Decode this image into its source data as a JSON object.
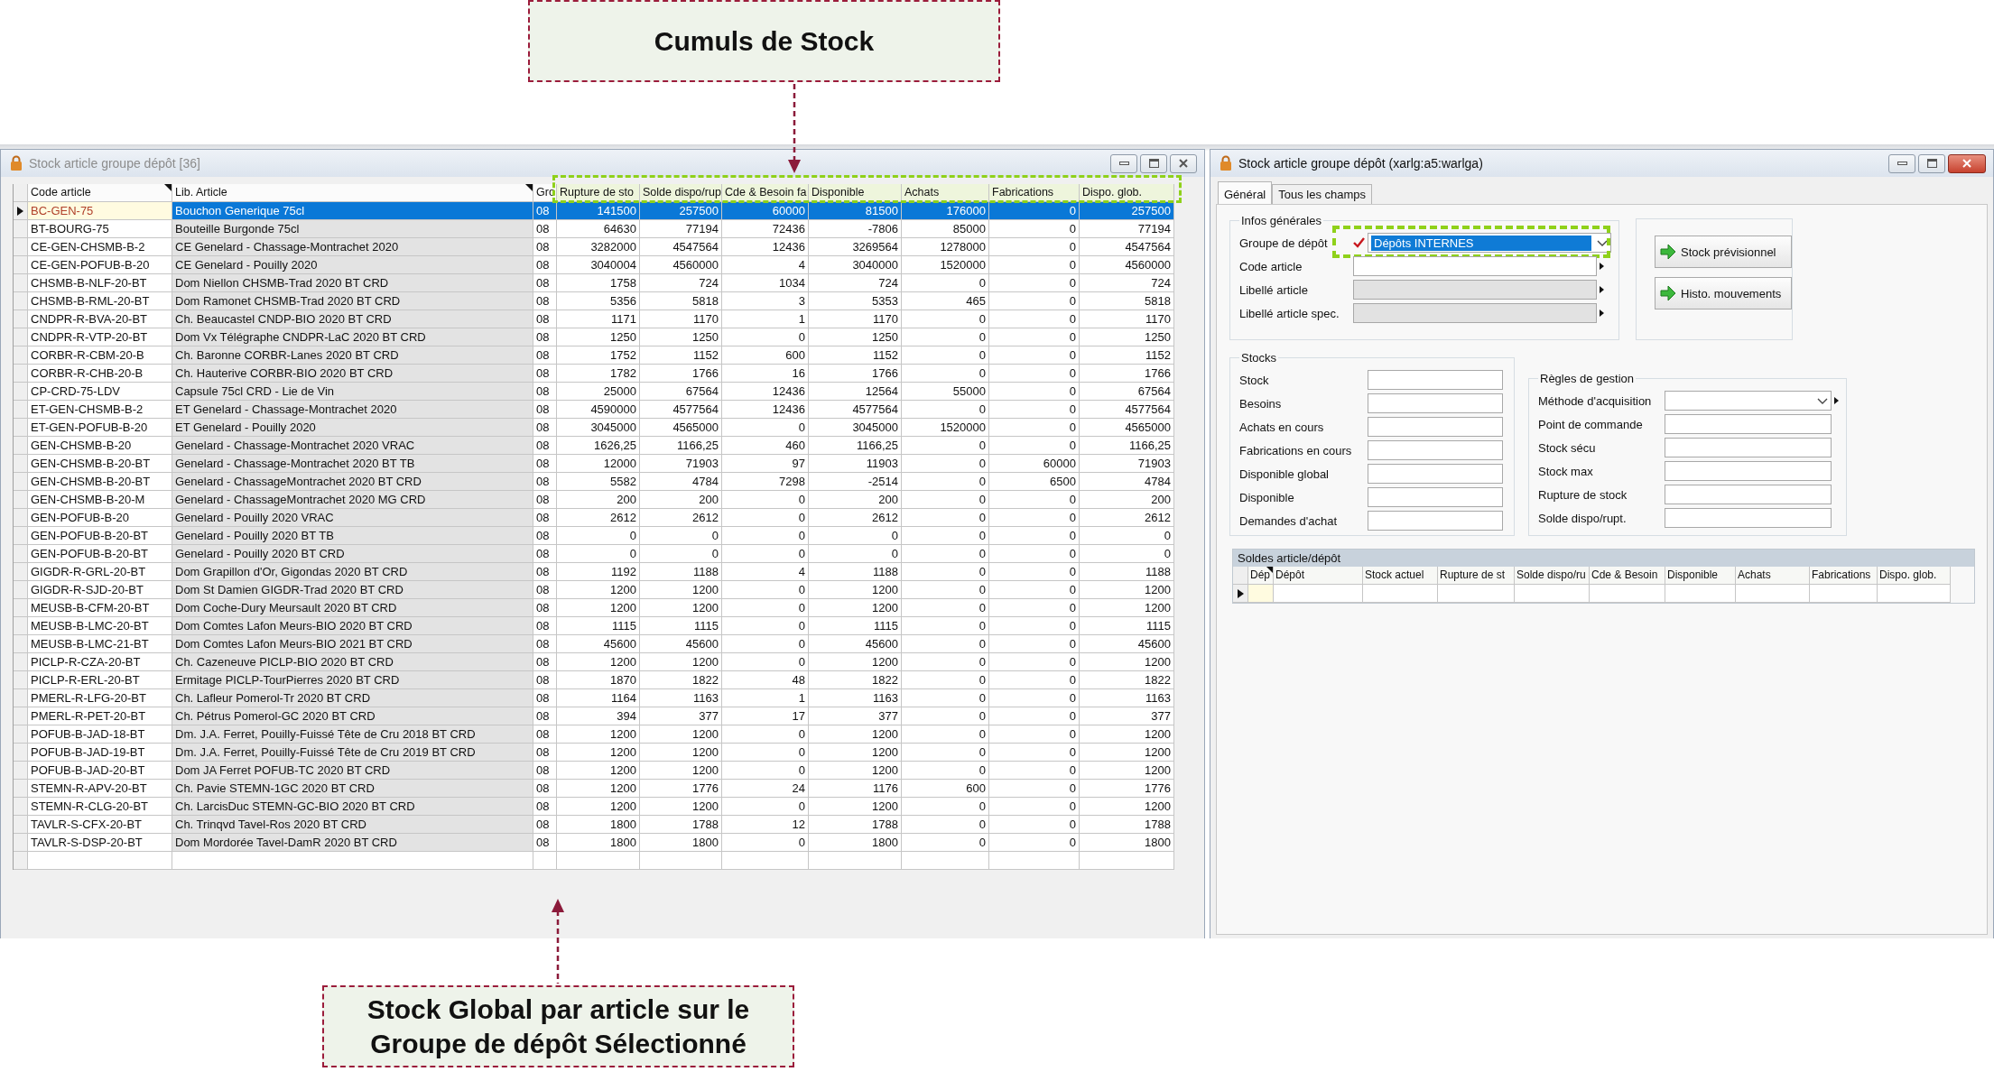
{
  "annotations": [
    {
      "text": "Cumuls de Stock"
    },
    {
      "text": "Stock Global par article sur le Groupe de dépôt Sélectionné"
    }
  ],
  "grid_window": {
    "title": "Stock article groupe dépôt [36]",
    "active": false,
    "columns": [
      {
        "label": "Code article",
        "sort_marker": true,
        "highlighted": false
      },
      {
        "label": "Lib. Article",
        "sort_marker": true,
        "highlighted": false
      },
      {
        "label": "Gro",
        "highlighted": false
      },
      {
        "label": "Rupture de sto",
        "highlighted": true
      },
      {
        "label": "Solde dispo/rup",
        "highlighted": true
      },
      {
        "label": "Cde & Besoin fa",
        "highlighted": true
      },
      {
        "label": "Disponible",
        "highlighted": true
      },
      {
        "label": "Achats",
        "highlighted": true
      },
      {
        "label": "Fabrications",
        "highlighted": true
      },
      {
        "label": "Dispo. glob.",
        "highlighted": true
      }
    ],
    "rows": [
      {
        "selected": true,
        "cells": [
          "BC-GEN-75",
          "Bouchon Generique 75cl",
          "08",
          "141500",
          "257500",
          "60000",
          "81500",
          "176000",
          "0",
          "257500"
        ]
      },
      {
        "selected": false,
        "cells": [
          "BT-BOURG-75",
          "Bouteille Burgonde 75cl",
          "08",
          "64630",
          "77194",
          "72436",
          "-7806",
          "85000",
          "0",
          "77194"
        ]
      },
      {
        "selected": false,
        "cells": [
          "CE-GEN-CHSMB-B-2",
          "CE Genelard - Chassage-Montrachet 2020",
          "08",
          "3282000",
          "4547564",
          "12436",
          "3269564",
          "1278000",
          "0",
          "4547564"
        ]
      },
      {
        "selected": false,
        "cells": [
          "CE-GEN-POFUB-B-20",
          "CE Genelard - Pouilly 2020",
          "08",
          "3040004",
          "4560000",
          "4",
          "3040000",
          "1520000",
          "0",
          "4560000"
        ]
      },
      {
        "selected": false,
        "cells": [
          "CHSMB-B-NLF-20-BT",
          "Dom Niellon CHSMB-Trad 2020 BT CRD",
          "08",
          "1758",
          "724",
          "1034",
          "724",
          "0",
          "0",
          "724"
        ]
      },
      {
        "selected": false,
        "cells": [
          "CHSMB-B-RML-20-BT",
          "Dom Ramonet CHSMB-Trad 2020 BT CRD",
          "08",
          "5356",
          "5818",
          "3",
          "5353",
          "465",
          "0",
          "5818"
        ]
      },
      {
        "selected": false,
        "cells": [
          "CNDPR-R-BVA-20-BT",
          "Ch. Beaucastel CNDP-BIO 2020 BT CRD",
          "08",
          "1171",
          "1170",
          "1",
          "1170",
          "0",
          "0",
          "1170"
        ]
      },
      {
        "selected": false,
        "cells": [
          "CNDPR-R-VTP-20-BT",
          "Dom Vx Télégraphe CNDPR-LaC 2020 BT CRD",
          "08",
          "1250",
          "1250",
          "0",
          "1250",
          "0",
          "0",
          "1250"
        ]
      },
      {
        "selected": false,
        "cells": [
          "CORBR-R-CBM-20-B",
          "Ch. Baronne CORBR-Lanes 2020 BT CRD",
          "08",
          "1752",
          "1152",
          "600",
          "1152",
          "0",
          "0",
          "1152"
        ]
      },
      {
        "selected": false,
        "cells": [
          "CORBR-R-CHB-20-B",
          "Ch. Hauterive CORBR-BIO 2020 BT CRD",
          "08",
          "1782",
          "1766",
          "16",
          "1766",
          "0",
          "0",
          "1766"
        ]
      },
      {
        "selected": false,
        "cells": [
          "CP-CRD-75-LDV",
          "Capsule 75cl CRD - Lie de Vin",
          "08",
          "25000",
          "67564",
          "12436",
          "12564",
          "55000",
          "0",
          "67564"
        ]
      },
      {
        "selected": false,
        "cells": [
          "ET-GEN-CHSMB-B-2",
          "ET Genelard - Chassage-Montrachet 2020",
          "08",
          "4590000",
          "4577564",
          "12436",
          "4577564",
          "0",
          "0",
          "4577564"
        ]
      },
      {
        "selected": false,
        "cells": [
          "ET-GEN-POFUB-B-20",
          "ET Genelard - Pouilly 2020",
          "08",
          "3045000",
          "4565000",
          "0",
          "3045000",
          "1520000",
          "0",
          "4565000"
        ]
      },
      {
        "selected": false,
        "cells": [
          "GEN-CHSMB-B-20",
          "Genelard - Chassage-Montrachet 2020 VRAC",
          "08",
          "1626,25",
          "1166,25",
          "460",
          "1166,25",
          "0",
          "0",
          "1166,25"
        ]
      },
      {
        "selected": false,
        "cells": [
          "GEN-CHSMB-B-20-BT",
          "Genelard - Chassage-Montrachet 2020 BT TB",
          "08",
          "12000",
          "71903",
          "97",
          "11903",
          "0",
          "60000",
          "71903"
        ]
      },
      {
        "selected": false,
        "cells": [
          "GEN-CHSMB-B-20-BT",
          "Genelard - ChassageMontrachet 2020 BT CRD",
          "08",
          "5582",
          "4784",
          "7298",
          "-2514",
          "0",
          "6500",
          "4784"
        ]
      },
      {
        "selected": false,
        "cells": [
          "GEN-CHSMB-B-20-M",
          "Genelard - ChassageMontrachet 2020 MG CRD",
          "08",
          "200",
          "200",
          "0",
          "200",
          "0",
          "0",
          "200"
        ]
      },
      {
        "selected": false,
        "cells": [
          "GEN-POFUB-B-20",
          "Genelard - Pouilly 2020 VRAC",
          "08",
          "2612",
          "2612",
          "0",
          "2612",
          "0",
          "0",
          "2612"
        ]
      },
      {
        "selected": false,
        "cells": [
          "GEN-POFUB-B-20-BT",
          "Genelard - Pouilly 2020 BT TB",
          "08",
          "0",
          "0",
          "0",
          "0",
          "0",
          "0",
          "0"
        ]
      },
      {
        "selected": false,
        "cells": [
          "GEN-POFUB-B-20-BT",
          "Genelard - Pouilly 2020 BT CRD",
          "08",
          "0",
          "0",
          "0",
          "0",
          "0",
          "0",
          "0"
        ]
      },
      {
        "selected": false,
        "cells": [
          "GIGDR-R-GRL-20-BT",
          "Dom Grapillon d'Or, Gigondas 2020 BT CRD",
          "08",
          "1192",
          "1188",
          "4",
          "1188",
          "0",
          "0",
          "1188"
        ]
      },
      {
        "selected": false,
        "cells": [
          "GIGDR-R-SJD-20-BT",
          "Dom St Damien GIGDR-Trad 2020 BT CRD",
          "08",
          "1200",
          "1200",
          "0",
          "1200",
          "0",
          "0",
          "1200"
        ]
      },
      {
        "selected": false,
        "cells": [
          "MEUSB-B-CFM-20-BT",
          "Dom Coche-Dury Meursault 2020 BT CRD",
          "08",
          "1200",
          "1200",
          "0",
          "1200",
          "0",
          "0",
          "1200"
        ]
      },
      {
        "selected": false,
        "cells": [
          "MEUSB-B-LMC-20-BT",
          "Dom Comtes Lafon Meurs-BIO 2020 BT CRD",
          "08",
          "1115",
          "1115",
          "0",
          "1115",
          "0",
          "0",
          "1115"
        ]
      },
      {
        "selected": false,
        "cells": [
          "MEUSB-B-LMC-21-BT",
          "Dom Comtes Lafon Meurs-BIO 2021 BT CRD",
          "08",
          "45600",
          "45600",
          "0",
          "45600",
          "0",
          "0",
          "45600"
        ]
      },
      {
        "selected": false,
        "cells": [
          "PICLP-R-CZA-20-BT",
          "Ch. Cazeneuve PICLP-BIO 2020 BT CRD",
          "08",
          "1200",
          "1200",
          "0",
          "1200",
          "0",
          "0",
          "1200"
        ]
      },
      {
        "selected": false,
        "cells": [
          "PICLP-R-ERL-20-BT",
          "Ermitage PICLP-TourPierres 2020 BT CRD",
          "08",
          "1870",
          "1822",
          "48",
          "1822",
          "0",
          "0",
          "1822"
        ]
      },
      {
        "selected": false,
        "cells": [
          "PMERL-R-LFG-20-BT",
          "Ch. Lafleur Pomerol-Tr 2020 BT CRD",
          "08",
          "1164",
          "1163",
          "1",
          "1163",
          "0",
          "0",
          "1163"
        ]
      },
      {
        "selected": false,
        "cells": [
          "PMERL-R-PET-20-BT",
          "Ch. Pétrus Pomerol-GC 2020 BT CRD",
          "08",
          "394",
          "377",
          "17",
          "377",
          "0",
          "0",
          "377"
        ]
      },
      {
        "selected": false,
        "cells": [
          "POFUB-B-JAD-18-BT",
          "Dm. J.A. Ferret, Pouilly-Fuissé Tête de Cru 2018 BT CRD",
          "08",
          "1200",
          "1200",
          "0",
          "1200",
          "0",
          "0",
          "1200"
        ]
      },
      {
        "selected": false,
        "cells": [
          "POFUB-B-JAD-19-BT",
          "Dm. J.A. Ferret, Pouilly-Fuissé Tête de Cru 2019 BT CRD",
          "08",
          "1200",
          "1200",
          "0",
          "1200",
          "0",
          "0",
          "1200"
        ]
      },
      {
        "selected": false,
        "cells": [
          "POFUB-B-JAD-20-BT",
          "Dom JA Ferret POFUB-TC 2020 BT CRD",
          "08",
          "1200",
          "1200",
          "0",
          "1200",
          "0",
          "0",
          "1200"
        ]
      },
      {
        "selected": false,
        "cells": [
          "STEMN-R-APV-20-BT",
          "Ch. Pavie STEMN-1GC 2020 BT CRD",
          "08",
          "1200",
          "1776",
          "24",
          "1176",
          "600",
          "0",
          "1776"
        ]
      },
      {
        "selected": false,
        "cells": [
          "STEMN-R-CLG-20-BT",
          "Ch. LarcisDuc STEMN-GC-BIO 2020 BT CRD",
          "08",
          "1200",
          "1200",
          "0",
          "1200",
          "0",
          "0",
          "1200"
        ]
      },
      {
        "selected": false,
        "cells": [
          "TAVLR-S-CFX-20-BT",
          "Ch. Trinqvd Tavel-Ros 2020 BT CRD",
          "08",
          "1800",
          "1788",
          "12",
          "1788",
          "0",
          "0",
          "1788"
        ]
      },
      {
        "selected": false,
        "cells": [
          "TAVLR-S-DSP-20-BT",
          "Dom Mordorée Tavel-DamR 2020 BT CRD",
          "08",
          "1800",
          "1800",
          "0",
          "1800",
          "0",
          "0",
          "1800"
        ]
      }
    ]
  },
  "detail_window": {
    "title": "Stock article groupe dépôt (xarlg:a5:warlga)",
    "active": true,
    "tabs": [
      {
        "label": "Général",
        "selected": true
      },
      {
        "label": "Tous les champs",
        "selected": false
      }
    ],
    "infos": {
      "title": "Infos générales",
      "fields": [
        {
          "label": "Groupe de dépôt",
          "kind": "dropdown",
          "value": "Dépôts INTERNES",
          "required": true,
          "highlighted": true
        },
        {
          "label": "Code article",
          "kind": "text",
          "lookup": true
        },
        {
          "label": "Libellé article",
          "kind": "readonly",
          "lookup": true
        },
        {
          "label": "Libellé article spec.",
          "kind": "readonly",
          "lookup": true
        }
      ]
    },
    "buttons": [
      "Stock prévisionnel",
      "Histo. mouvements"
    ],
    "stocks": {
      "title": "Stocks",
      "fields": [
        {
          "label": "Stock",
          "kind": "text"
        },
        {
          "label": "Besoins",
          "kind": "text"
        },
        {
          "label": "Achats en cours",
          "kind": "text"
        },
        {
          "label": "Fabrications en cours",
          "kind": "text"
        },
        {
          "label": "Disponible global",
          "kind": "text"
        },
        {
          "label": "Disponible",
          "kind": "text"
        },
        {
          "label": "Demandes d'achat",
          "kind": "text"
        }
      ]
    },
    "rules": {
      "title": "Règles de gestion",
      "fields": [
        {
          "label": "Méthode d'acquisition",
          "kind": "dropdown",
          "lookup": true
        },
        {
          "label": "Point de commande",
          "kind": "text"
        },
        {
          "label": "Stock sécu",
          "kind": "text"
        },
        {
          "label": "Stock max",
          "kind": "text"
        },
        {
          "label": "Rupture de stock",
          "kind": "text"
        },
        {
          "label": "Solde dispo/rupt.",
          "kind": "text"
        }
      ]
    },
    "soldes": {
      "title": "Soldes article/dépôt",
      "current_row": true,
      "columns": [
        {
          "label": "Dép",
          "sort_marker": true
        },
        {
          "label": "Dépôt"
        },
        {
          "label": "Stock actuel"
        },
        {
          "label": "Rupture de st"
        },
        {
          "label": "Solde dispo/ru"
        },
        {
          "label": "Cde & Besoin"
        },
        {
          "label": "Disponible"
        },
        {
          "label": "Achats"
        },
        {
          "label": "Fabrications"
        },
        {
          "label": "Dispo. glob."
        }
      ]
    }
  }
}
